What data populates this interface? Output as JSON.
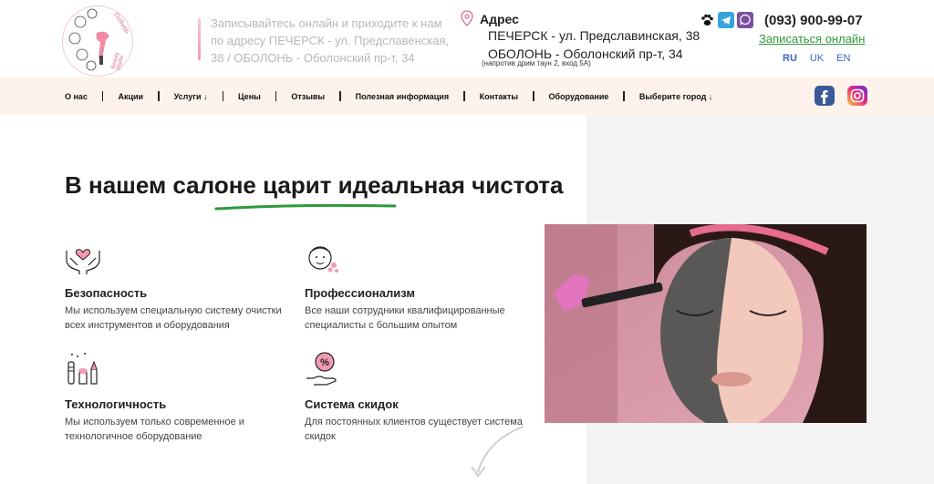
{
  "header": {
    "logo": {
      "brand_text": "DoReMi",
      "sub_text": "Beauty Studio"
    },
    "intro_text": "Записывайтесь онлайн и приходите к нам по адресу ПЕЧЕРСК - ул. Предславенская, 38 / ОБОЛОНЬ - Оболонский пр-т, 34",
    "address_title": "Адрес",
    "address_1": "ПЕЧЕРСК - ул. Предславинская, 38",
    "address_2": "ОБОЛОНЬ - Оболонский пр-т, 34",
    "address_note": "(напротив дрим таун 2, вход 5А)",
    "messengers": [
      "paw-icon",
      "telegram-icon",
      "viber-icon"
    ],
    "phone": "(093) 900-99-07",
    "signup_label": "Записаться онлайн",
    "languages": [
      "RU",
      "UK",
      "EN"
    ],
    "active_language": "RU"
  },
  "nav": {
    "items": [
      "О нас",
      "Акции",
      "Услуги ↓",
      "Цены",
      "Отзывы",
      "Полезная информация",
      "Контакты",
      "Оборудование",
      "Выберите город ↓"
    ],
    "social": [
      "facebook-icon",
      "instagram-icon"
    ]
  },
  "main": {
    "title": "В нашем салоне царит идеальная чистота",
    "features": [
      {
        "icon": "hands-heart-icon",
        "heading": "Безопасность",
        "text": "Мы используем специальную систему очистки всех инструментов и оборудования"
      },
      {
        "icon": "face-mask-icon",
        "heading": "Профессионализм",
        "text": "Все наши сотрудники квалифицированные специалисты с большим опытом"
      },
      {
        "icon": "cosmetics-icon",
        "heading": "Технологичность",
        "text": "Мы используем только современное и технологичное оборудование"
      },
      {
        "icon": "discount-hand-icon",
        "heading": "Система скидок",
        "text": "Для постоянных клиентов существует система скидок"
      }
    ]
  },
  "colors": {
    "accent_pink": "#e46a8d",
    "link_green": "#2f9a3c",
    "lang_blue": "#3a64c8",
    "nav_bg": "#fdf3ec",
    "panel_grey": "#f3f3f3"
  }
}
